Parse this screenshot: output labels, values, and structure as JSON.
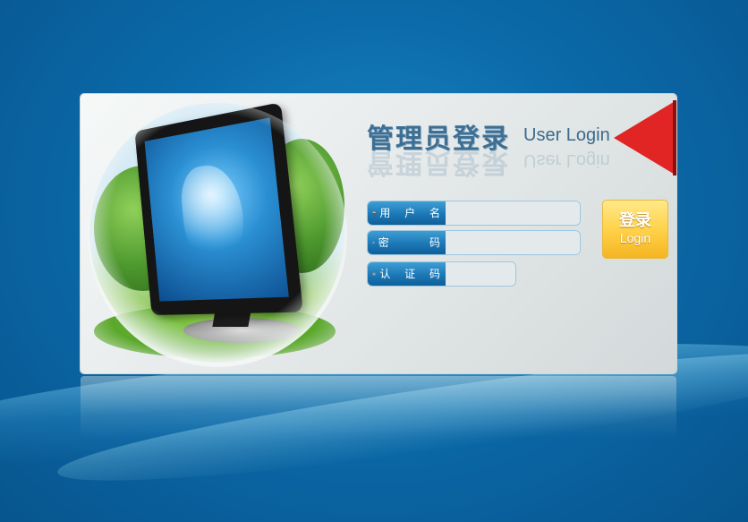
{
  "title": {
    "cn": "管理员登录",
    "en": "User Login"
  },
  "form": {
    "username": {
      "label": "用户名",
      "label_display": "用 户 名",
      "value": "",
      "placeholder": ""
    },
    "password": {
      "label": "密码",
      "label_display": "密    码",
      "value": "",
      "placeholder": ""
    },
    "captcha": {
      "label": "认证码",
      "label_display": "认 证 码",
      "value": "",
      "placeholder": ""
    }
  },
  "login_button": {
    "cn": "登录",
    "en": "Login"
  },
  "icons": {
    "username": "users-icon",
    "password": "key-icon",
    "captcha": "box-icon"
  },
  "colors": {
    "background": "#0b6aa9",
    "field_label": "#1b78b6",
    "login_button": "#ffd24a",
    "flag": "#e12424"
  }
}
